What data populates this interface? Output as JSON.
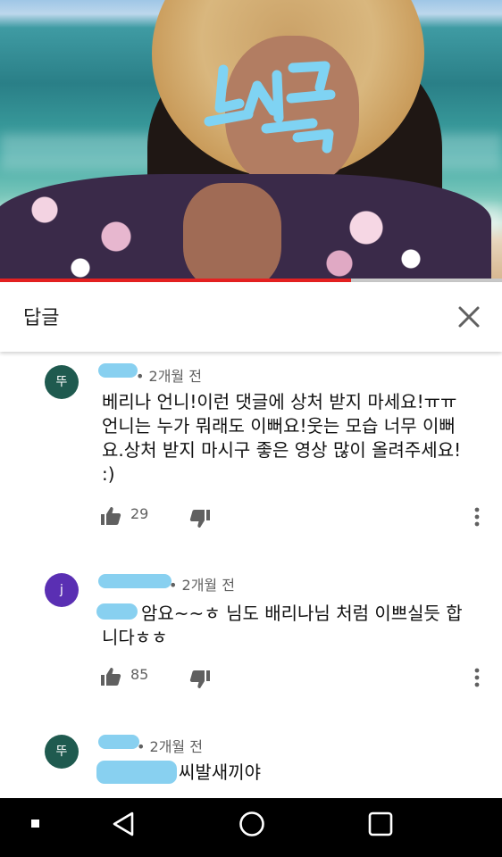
{
  "reply_panel": {
    "title": "답글",
    "video_progress": 0.7
  },
  "comments": [
    {
      "avatar_letter": "뚜",
      "avatar_color": "#1f5a4f",
      "time": "• 2개월 전",
      "text": "베리나 언니!이런 댓글에 상처 받지 마세요!ㅠㅠ 언니는 누가 뭐래도 이뻐요!웃는 모습 너무 이뻐요.상처 받지 마시구 좋은 영상 많이 올려주세요! :)",
      "likes": "29"
    },
    {
      "avatar_letter": "j",
      "avatar_color": "#5a2fb3",
      "time": "• 2개월 전",
      "text": "암요~~ㅎ 님도 배리나님 처럼 이쁘실듯 합니다ㅎㅎ",
      "likes": "85"
    },
    {
      "avatar_letter": "뚜",
      "avatar_color": "#1f5a4f",
      "time": "• 2개월 전",
      "text": "씨발새끼야"
    }
  ],
  "icons": {
    "close": "close-icon",
    "like": "thumbs-up-icon",
    "dislike": "thumbs-down-icon",
    "more": "more-vert-icon",
    "nav_back": "back-triangle-icon",
    "nav_home": "home-circle-icon",
    "nav_recent": "recent-square-icon"
  }
}
